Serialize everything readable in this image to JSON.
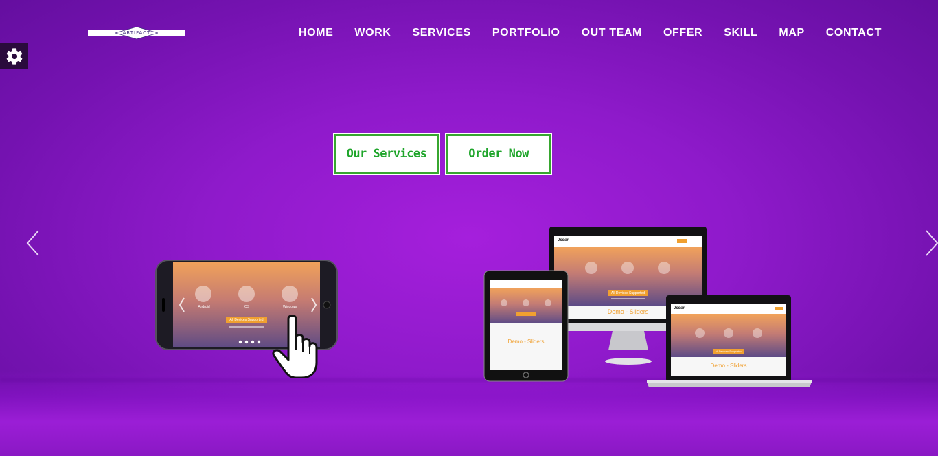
{
  "logo": {
    "text": "ARTIFACT"
  },
  "nav": {
    "items": [
      "HOME",
      "WORK",
      "SERVICES",
      "PORTFOLIO",
      "OUT TEAM",
      "OFFER",
      "SKILL",
      "MAP",
      "CONTACT"
    ]
  },
  "hero": {
    "buttons": {
      "services": "Our Services",
      "order": "Order Now"
    }
  },
  "devices": {
    "phone": {
      "labels": [
        "Android",
        "iOS",
        "Windows"
      ],
      "badge": "All Devices Supported"
    },
    "monitor": {
      "brand": "Jssor",
      "badge": "All Devices Supported",
      "caption": "Demo - Sliders"
    },
    "tablet": {
      "caption": "Demo - Sliders"
    },
    "laptop": {
      "brand": "Jssor",
      "badge": "All Devices Supported",
      "caption": "Demo - Sliders"
    }
  },
  "colors": {
    "background": "#9b1ed6",
    "button_border": "#37a62f",
    "button_text": "#1fa52b",
    "settings_bg": "#2a0b3d"
  },
  "icons": {
    "settings": "gear-icon",
    "prev": "chevron-left-icon",
    "next": "chevron-right-icon",
    "hand": "pointing-hand-icon"
  }
}
